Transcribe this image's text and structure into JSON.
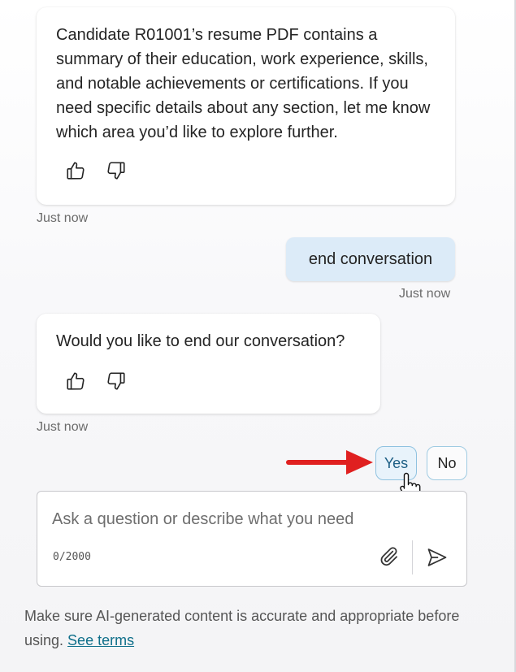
{
  "messages": [
    {
      "role": "bot",
      "text": "Candidate R01001’s resume PDF contains a summary of their education, work experience, skills, and notable achievements or certifications. If you need specific details about any section, let me know which area you’d like to explore further.",
      "timestamp": "Just now"
    },
    {
      "role": "user",
      "text": "end conversation",
      "timestamp": "Just now"
    },
    {
      "role": "bot",
      "text": "Would you like to end our conversation?",
      "timestamp": "Just now"
    }
  ],
  "quick_replies": {
    "yes": "Yes",
    "no": "No"
  },
  "composer": {
    "placeholder": "Ask a question or describe what you need",
    "value": "",
    "counter": "0/2000"
  },
  "disclaimer": {
    "text": "Make sure AI-generated content is accurate and appropriate before using. ",
    "link": "See terms"
  },
  "icons": {
    "thumbs_up": "thumbs-up-icon",
    "thumbs_down": "thumbs-down-icon",
    "attach": "paperclip-icon",
    "send": "send-icon",
    "annotation_arrow": "red-arrow",
    "cursor": "hand-pointer-cursor"
  },
  "colors": {
    "user_bubble": "#dcebf8",
    "link": "#0f6f8a",
    "yes_text": "#1c5e84",
    "arrow": "#e02020"
  }
}
